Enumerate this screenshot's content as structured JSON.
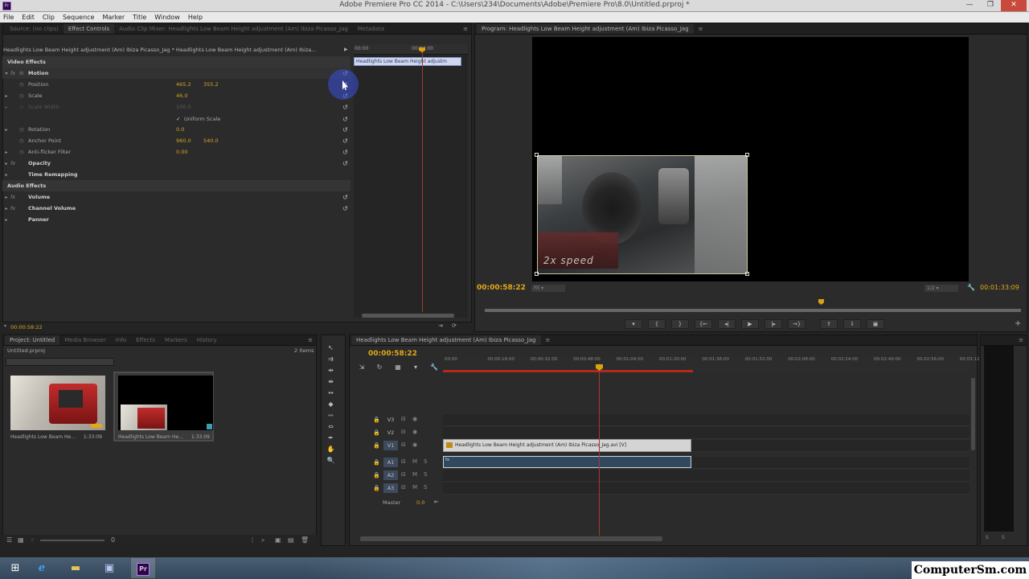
{
  "window": {
    "title": "Adobe Premiere Pro CC 2014 - C:\\Users\\234\\Documents\\Adobe\\Premiere Pro\\8.0\\Untitled.prproj *",
    "app_icon": "Pr",
    "minimize": "—",
    "maximize": "❐",
    "close": "✕"
  },
  "menu": [
    "File",
    "Edit",
    "Clip",
    "Sequence",
    "Marker",
    "Title",
    "Window",
    "Help"
  ],
  "effect_controls": {
    "tabs": [
      "Source: (no clips)",
      "Effect Controls",
      "Audio Clip Mixer: Headlights Low Beam Height adjustment (Am) Ibiza Picasso_Jag",
      "Metadata"
    ],
    "clip_header": "Headlights Low Beam Height adjustment (Am) Ibiza Picasso_Jag * Headlights Low Beam Height adjustment (Am) Ibiza...",
    "ruler_start": "00:00",
    "ruler_mark": "00:04:00",
    "clip_bar": "Headlights Low Beam Height adjustm",
    "timecode": "00:00:58:22",
    "sections": {
      "video": "Video Effects",
      "audio": "Audio Effects"
    },
    "rows": {
      "motion": "Motion",
      "position": {
        "label": "Position",
        "x": "465.2",
        "y": "355.2"
      },
      "scale": {
        "label": "Scale",
        "value": "46.0"
      },
      "scale_width": {
        "label": "Scale Width",
        "value": "100.0"
      },
      "uniform_scale": "Uniform Scale",
      "rotation": {
        "label": "Rotation",
        "value": "0.0"
      },
      "anchor_point": {
        "label": "Anchor Point",
        "x": "960.0",
        "y": "540.0"
      },
      "anti_flicker": {
        "label": "Anti-flicker Filter",
        "value": "0.00"
      },
      "opacity": "Opacity",
      "time_remapping": "Time Remapping",
      "volume": "Volume",
      "channel_volume": "Channel Volume",
      "panner": "Panner"
    }
  },
  "program": {
    "tab": "Program: Headlights Low Beam Height adjustment (Am) Ibiza Picasso_Jag",
    "timecode": "00:00:58:22",
    "duration": "00:01:33:09",
    "fit": "Fit",
    "resolution": "1/2",
    "caption": "2x speed",
    "buttons": [
      "▾",
      "{",
      "}",
      "{←",
      "◂|",
      "▶",
      "|▸",
      "→}",
      "⇪",
      "⇩",
      "▣"
    ]
  },
  "project": {
    "tabs": [
      "Project: Untitled",
      "Media Browser",
      "Info",
      "Effects",
      "Markers",
      "History"
    ],
    "name": "Untitled.prproj",
    "items_count": "2 Items",
    "items": [
      {
        "label": "Headlights Low Beam He...",
        "duration": "1:33:09"
      },
      {
        "label": "Headlights Low Beam He...",
        "duration": "1:33:09"
      }
    ],
    "footer_zero": "0"
  },
  "timeline": {
    "tab": "Headlights Low Beam Height adjustment (Am) Ibiza Picasso_Jag",
    "timecode": "00:00:58:22",
    "ruler_ticks": [
      "00:00",
      "00:00:16:00",
      "00:00:32:00",
      "00:00:48:00",
      "00:01:04:00",
      "00:01:20:00",
      "00:01:36:00",
      "00:01:52:00",
      "00:02:08:00",
      "00:02:24:00",
      "00:02:40:00",
      "00:02:56:00",
      "00:03:12:00"
    ],
    "tracks": {
      "v3": "V3",
      "v2": "V2",
      "v1": "V1",
      "a1": "A1",
      "a2": "A2",
      "a3": "A3"
    },
    "clip_video": "Headlights Low Beam Height adjustment (Am) Ibiza Picasso_Jag.avi [V]",
    "clip_audio": "fx",
    "master_label": "Master",
    "master_value": "0.0"
  },
  "meters": {
    "solo_1": "S",
    "solo_2": "S"
  },
  "watermark": "ComputerSm.com"
}
